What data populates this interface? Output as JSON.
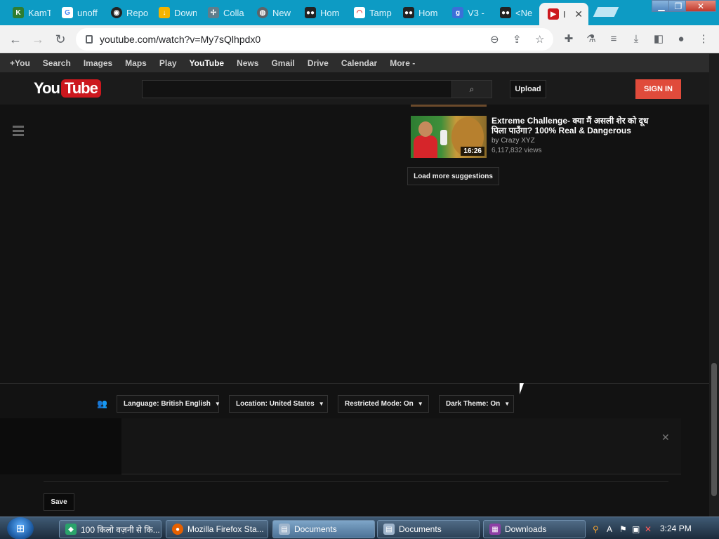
{
  "browser": {
    "tabs": [
      {
        "label": "KamT",
        "icon": "kamtv-icon",
        "color": "#2e7d32"
      },
      {
        "label": "unoff",
        "icon": "google-icon",
        "color": "#4285f4"
      },
      {
        "label": "Repo",
        "icon": "github-icon",
        "color": "#222222"
      },
      {
        "label": "Down",
        "icon": "download-site-icon",
        "color": "#f4b400"
      },
      {
        "label": "Colla",
        "icon": "pinwheel-icon",
        "color": "#607d8b"
      },
      {
        "label": "New",
        "icon": "globe-icon",
        "color": "#5f6368"
      },
      {
        "label": "Hom",
        "icon": "tampermonkey-icon",
        "color": "#222222"
      },
      {
        "label": "Tamp",
        "icon": "rainbow-icon",
        "color": "#e53935"
      },
      {
        "label": "Hom",
        "icon": "tampermonkey-icon",
        "color": "#222222"
      },
      {
        "label": "V3 -",
        "icon": "google-g-icon",
        "color": "#3b6fd8"
      },
      {
        "label": "<Ne",
        "icon": "tampermonkey-icon",
        "color": "#222222"
      },
      {
        "label": "I",
        "icon": "youtube-icon",
        "color": "#cc181e",
        "active": true
      }
    ],
    "close_glyph": "✕",
    "url": "youtube.com/watch?v=My7sQlhpdx0"
  },
  "gbar": {
    "items": [
      "+You",
      "Search",
      "Images",
      "Maps",
      "Play",
      "YouTube",
      "News",
      "Gmail",
      "Drive",
      "Calendar",
      "More -"
    ]
  },
  "youtube": {
    "logo_you": "You",
    "logo_tube": "Tube",
    "upload": "Upload",
    "sign_in": "SIGN IN",
    "suggestion": {
      "title": "Extreme Challenge- क्या मैं असली शेर को दूध पिला पाउँगा? 100% Real & Dangerous",
      "by": "by Crazy XYZ",
      "views": "6,117,832 views",
      "duration": "16:26"
    },
    "load_more": "Load more suggestions",
    "footer": {
      "language": "Language: British English",
      "location": "Location: United States",
      "restricted": "Restricted Mode: On",
      "dark_theme": "Dark Theme: On",
      "save": "Save",
      "close_glyph": "✕"
    }
  },
  "taskbar": {
    "tasks": [
      {
        "label": "100 किलो वज़नी से कि...",
        "icon": "app-icon",
        "color": "#2aa36b"
      },
      {
        "label": "Mozilla Firefox Sta...",
        "icon": "firefox-icon",
        "color": "#e66000"
      },
      {
        "label": "Documents",
        "icon": "folder-icon",
        "color": "#9fb5cc",
        "active": true
      },
      {
        "label": "Documents",
        "icon": "folder-icon",
        "color": "#9fb5cc"
      },
      {
        "label": "Downloads",
        "icon": "winrar-icon",
        "color": "#8e3fa5"
      }
    ],
    "clock": "3:24 PM"
  }
}
